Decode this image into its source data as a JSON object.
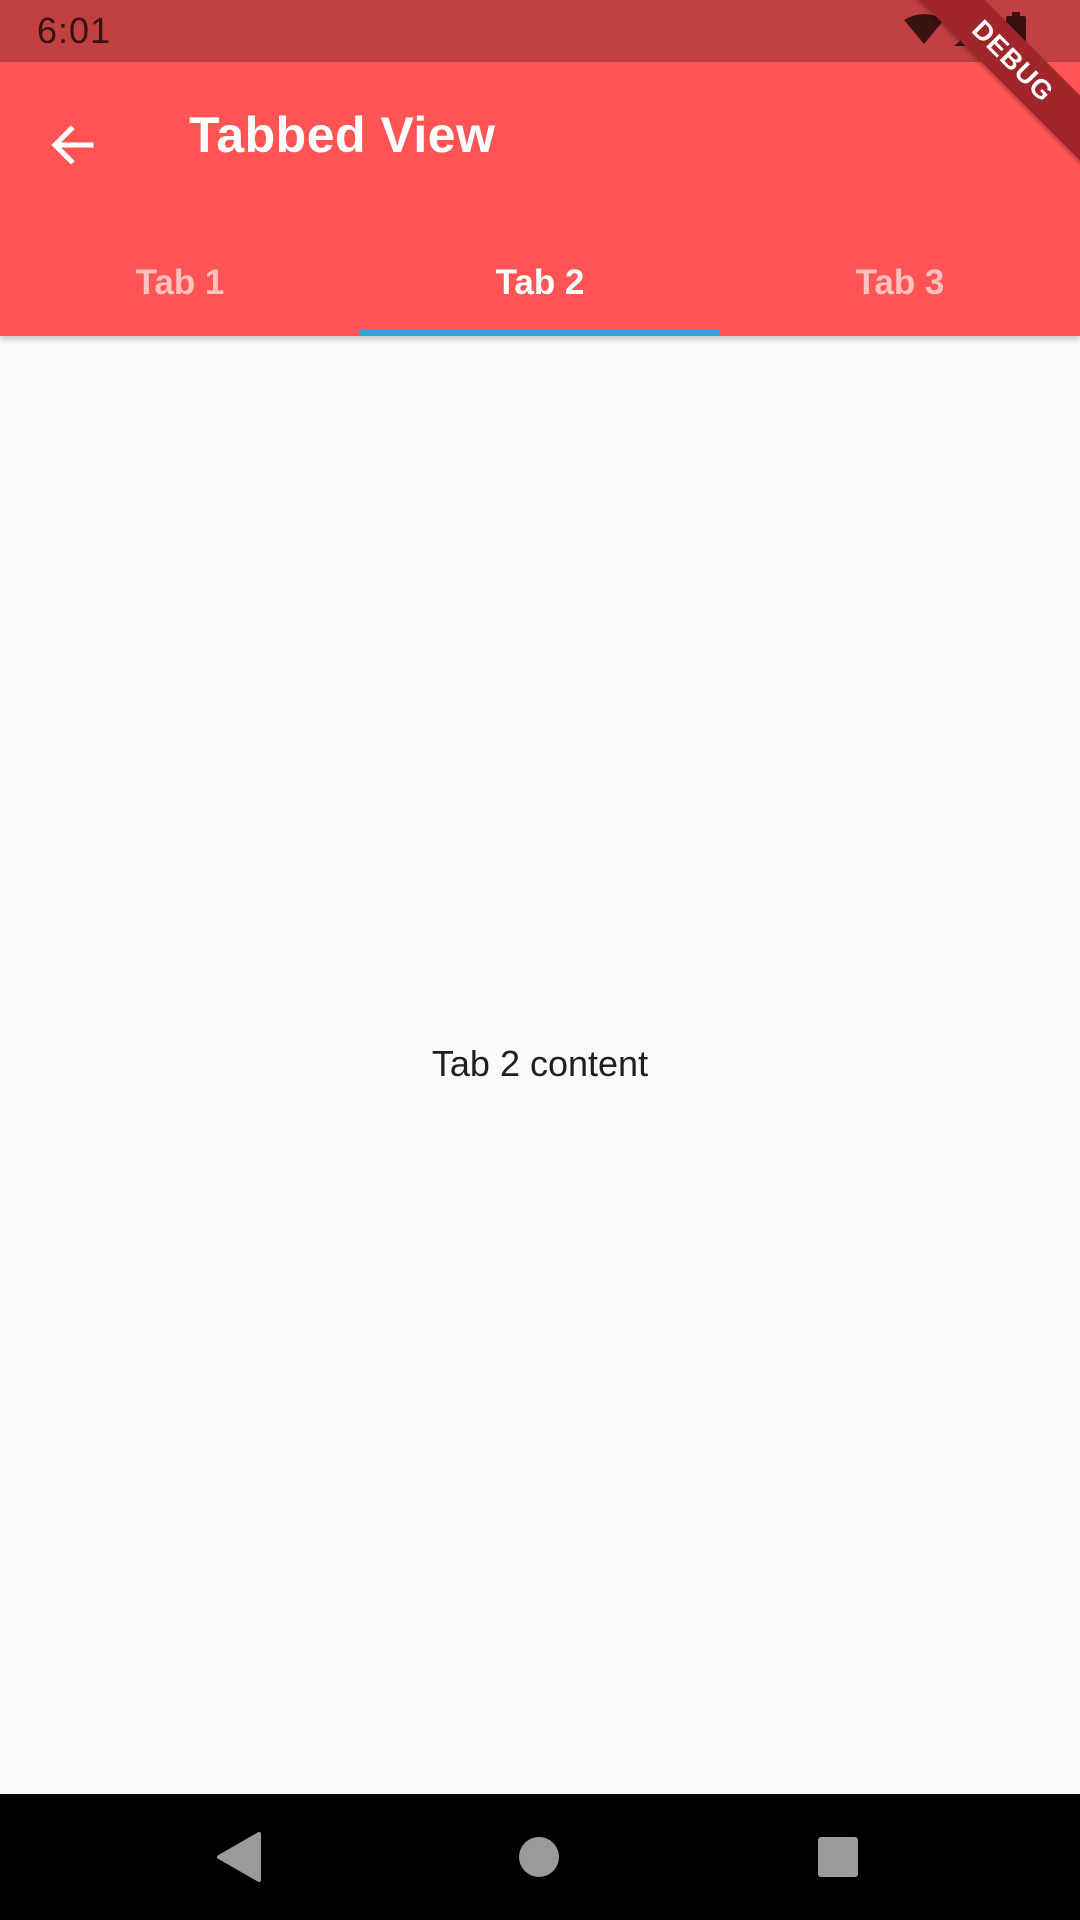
{
  "status_bar": {
    "time": "6:01",
    "icons": [
      "wifi-icon",
      "signal-icon",
      "battery-icon"
    ]
  },
  "debug_banner": "DEBUG",
  "app_bar": {
    "title": "Tabbed View",
    "back_icon": "arrow-back-icon",
    "color": "#ff5454"
  },
  "tabs": [
    {
      "label": "Tab 1",
      "active": false
    },
    {
      "label": "Tab 2",
      "active": true
    },
    {
      "label": "Tab 3",
      "active": false
    }
  ],
  "indicator_color": "#3f9bf0",
  "content": {
    "text": "Tab 2 content"
  },
  "nav_bar": {
    "buttons": [
      "back-triangle-icon",
      "home-circle-icon",
      "recents-square-icon"
    ]
  }
}
